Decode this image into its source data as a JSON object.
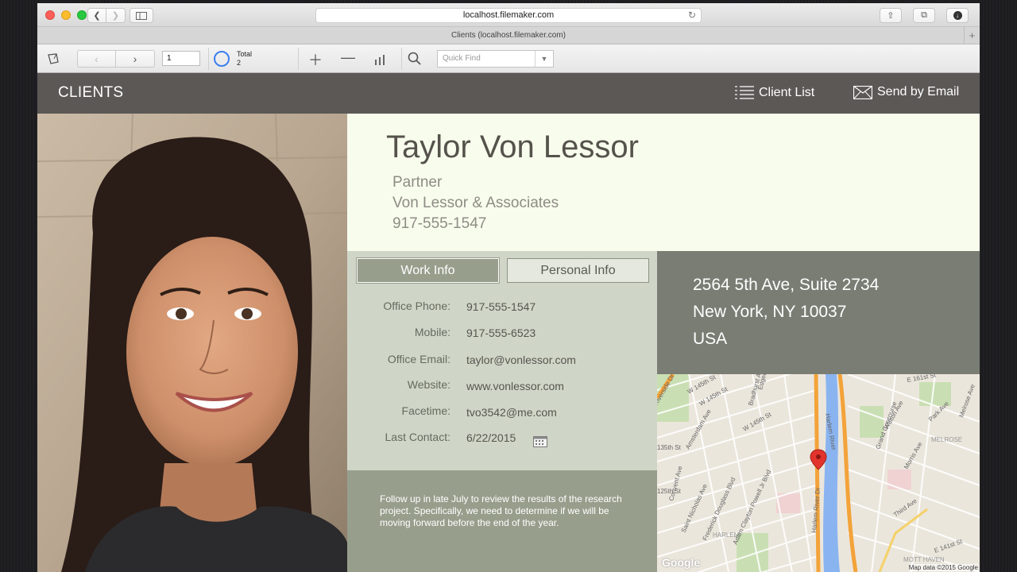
{
  "browser": {
    "url": "localhost.filemaker.com",
    "tab_title": "Clients (localhost.filemaker.com)"
  },
  "fm_toolbar": {
    "record_number": "1",
    "total_label": "Total",
    "total_count": "2",
    "quick_find_placeholder": "Quick Find"
  },
  "header": {
    "title": "CLIENTS",
    "client_list_label": "Client List",
    "send_email_label": "Send by Email"
  },
  "client": {
    "name": "Taylor Von Lessor",
    "title": "Partner",
    "company": "Von Lessor & Associates",
    "phone": "917-555-1547"
  },
  "tabs": {
    "work": "Work Info",
    "personal": "Personal Info"
  },
  "fields": [
    {
      "label": "Office Phone:",
      "value": "917-555-1547"
    },
    {
      "label": "Mobile:",
      "value": "917-555-6523"
    },
    {
      "label": "Office Email:",
      "value": "taylor@vonlessor.com"
    },
    {
      "label": "Website:",
      "value": "www.vonlessor.com"
    },
    {
      "label": "Facetime:",
      "value": "tvo3542@me.com"
    },
    {
      "label": "Last Contact:",
      "value": "6/22/2015"
    }
  ],
  "notes": "Follow up in late July to review the results of the research project. Specifically, we need to determine if we will be moving forward before the end of the year.",
  "address": {
    "line1": "2564 5th Ave, Suite 2734",
    "line2": "New York, NY  10037",
    "line3": "USA"
  },
  "map": {
    "credit": "Map data ©2015 Google",
    "logo": "Google",
    "labels": [
      "Riverside Dr",
      "W 145th St",
      "Amsterdam Ave",
      "W 145th St",
      "Convent Ave",
      "Bradhurst Ave",
      "Edgecombe Ave",
      "W 145th St",
      "Harlem River",
      "Grand Concourse",
      "E 161st St",
      "Park Ave",
      "Melrose Ave",
      "MELROSE",
      "Saint Nicholas Ave",
      "Frederick Douglass Blvd",
      "Adam Clayton Powell Jr Blvd",
      "Harlem River Dr",
      "Walton Ave",
      "Morris Ave",
      "Third Ave",
      "HARLEM",
      "MOTT HAVEN",
      "E 141st St",
      "135th St",
      "125th St"
    ]
  },
  "colors": {
    "header_bg": "#5b5856",
    "name_panel_bg": "#f7fcec",
    "info_panel_bg": "#d0d6c7",
    "accent_sage": "#979e8c",
    "address_bg": "#7a7d74"
  }
}
